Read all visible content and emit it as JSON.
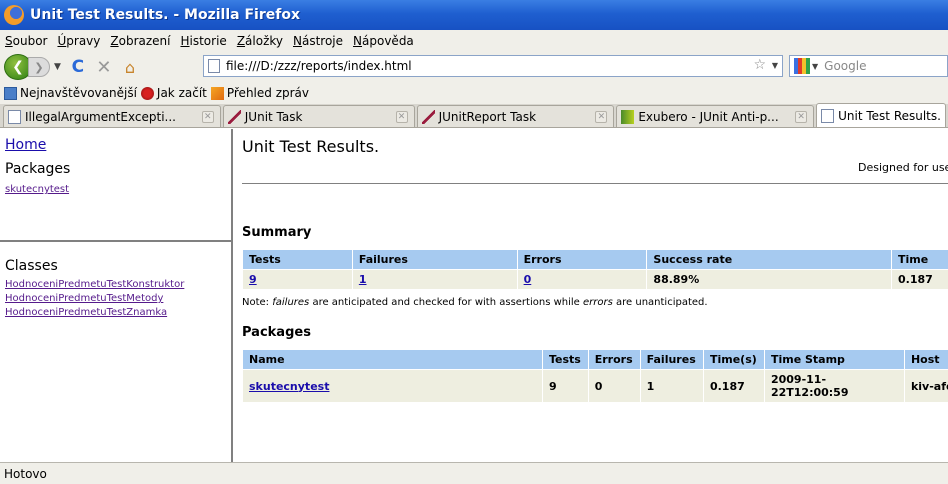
{
  "window": {
    "title": "Unit Test Results. - Mozilla Firefox"
  },
  "menu": [
    "Soubor",
    "Úpravy",
    "Zobrazení",
    "Historie",
    "Záložky",
    "Nástroje",
    "Nápověda"
  ],
  "nav": {
    "url": "file:///D:/zzz/reports/index.html",
    "search_placeholder": "Google"
  },
  "bookmarks": [
    "Nejnavštěvovanější",
    "Jak začít",
    "Přehled zpráv"
  ],
  "tabs": [
    "IllegalArgumentExcepti...",
    "JUnit Task",
    "JUnitReport Task",
    "Exubero - JUnit Anti-p...",
    "Unit Test Results."
  ],
  "sidebar": {
    "home": "Home",
    "packages_heading": "Packages",
    "packages": [
      "skutecnytest"
    ],
    "classes_heading": "Classes",
    "classes": [
      "HodnoceniPredmetuTestKonstruktor",
      "HodnoceniPredmetuTestMetody",
      "HodnoceniPredmetuTestZnamka"
    ]
  },
  "main": {
    "title": "Unit Test Results.",
    "designed": "Designed for use with",
    "summary_heading": "Summary",
    "summary_headers": [
      "Tests",
      "Failures",
      "Errors",
      "Success rate",
      "Time"
    ],
    "summary_values": [
      "9",
      "1",
      "0",
      "88.89%",
      "0.187"
    ],
    "note_prefix": "Note: ",
    "note_failures": "failures",
    "note_mid": " are anticipated and checked for with assertions while ",
    "note_errors": "errors",
    "note_suffix": " are unanticipated.",
    "packages_heading": "Packages",
    "packages_headers": [
      "Name",
      "Tests",
      "Errors",
      "Failures",
      "Time(s)",
      "Time Stamp",
      "Host"
    ],
    "packages_rows": [
      [
        "skutecnytest",
        "9",
        "0",
        "1",
        "0.187",
        "2009-11-22T12:00:59",
        "kiv-afd"
      ]
    ]
  },
  "status": "Hotovo"
}
